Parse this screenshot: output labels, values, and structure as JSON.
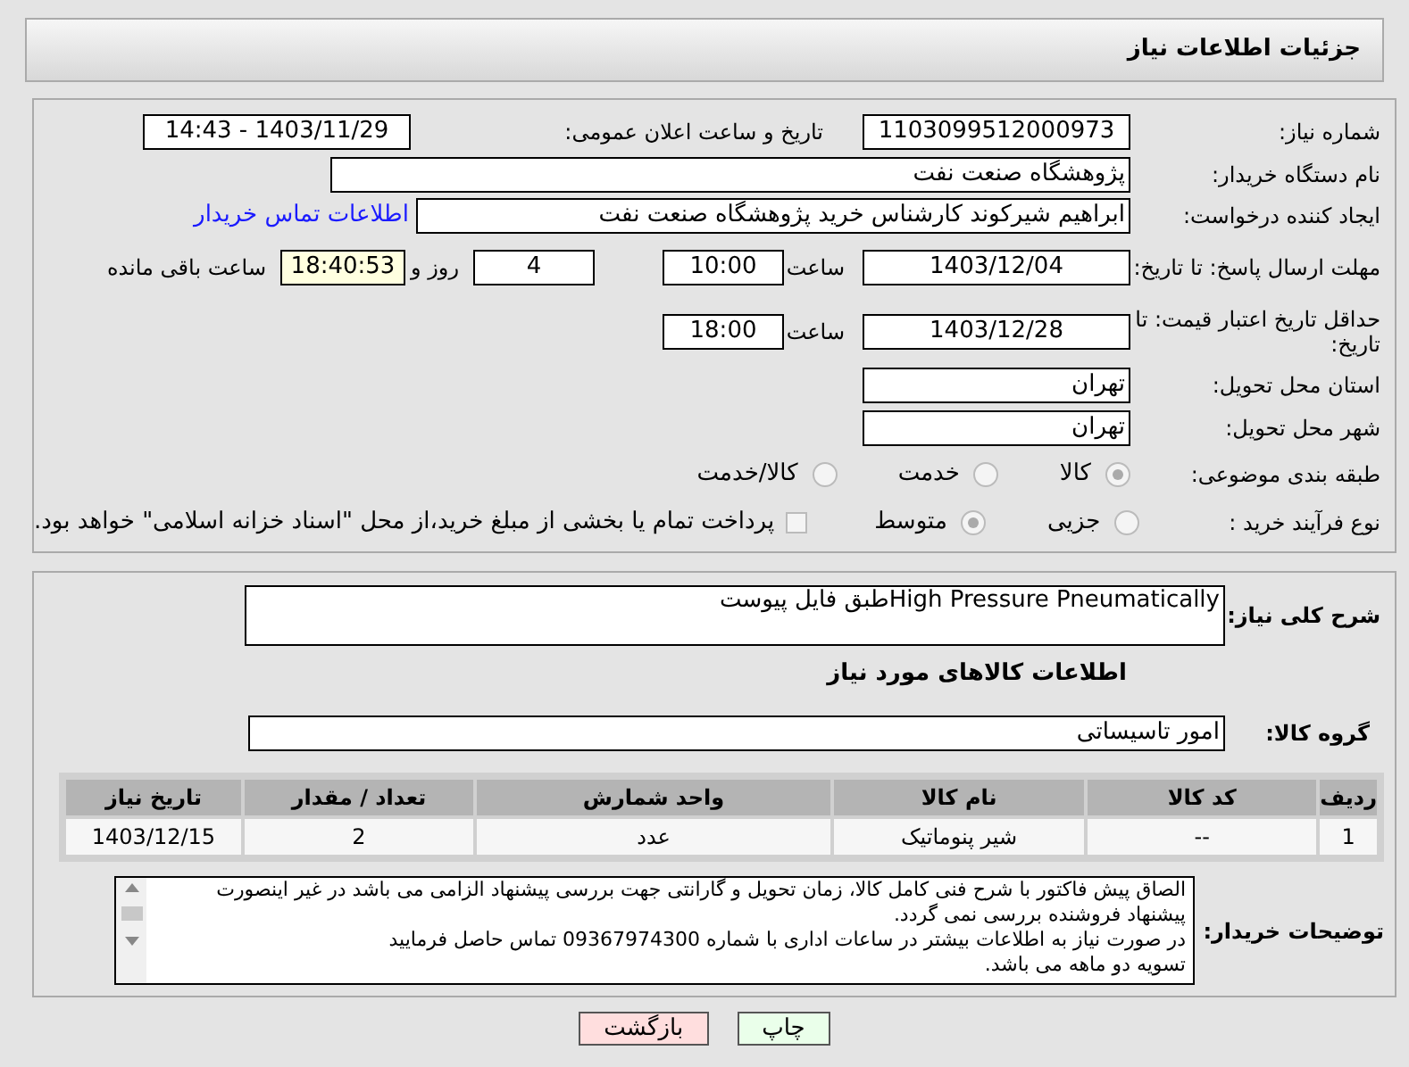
{
  "header": {
    "title": "جزئیات اطلاعات نیاز"
  },
  "need_number": {
    "label": "شماره نیاز:",
    "value": "1103099512000973"
  },
  "announce": {
    "label": "تاریخ و ساعت اعلان عمومی:",
    "value": "1403/11/29 - 14:43"
  },
  "buyer_org": {
    "label": "نام دستگاه خریدار:",
    "value": "پژوهشگاه صنعت نفت"
  },
  "requester": {
    "label": "ایجاد کننده درخواست:",
    "value": "ابراهیم شیرکوند کارشناس خرید پژوهشگاه صنعت نفت",
    "link": "اطلاعات تماس خریدار"
  },
  "reply_deadline": {
    "label": "مهلت ارسال پاسخ: تا تاریخ:",
    "date": "1403/12/04",
    "time_label": "ساعت",
    "time": "10:00",
    "days": "4",
    "days_label": "روز و",
    "remaining": "18:40:53",
    "remaining_label": "ساعت باقی مانده"
  },
  "price_validity": {
    "label": "حداقل تاریخ اعتبار قیمت: تا تاریخ:",
    "date": "1403/12/28",
    "time_label": "ساعت",
    "time": "18:00"
  },
  "province": {
    "label": "استان محل تحویل:",
    "value": "تهران"
  },
  "city": {
    "label": "شهر محل تحویل:",
    "value": "تهران"
  },
  "category": {
    "label": "طبقه بندی موضوعی:",
    "options": [
      {
        "label": "کالا",
        "selected": true
      },
      {
        "label": "خدمت",
        "selected": false
      },
      {
        "label": "کالا/خدمت",
        "selected": false
      }
    ]
  },
  "process": {
    "label": "نوع فرآیند خرید :",
    "options": [
      {
        "label": "جزیی",
        "selected": false
      },
      {
        "label": "متوسط",
        "selected": true
      }
    ],
    "treasury": {
      "label": "پرداخت تمام یا بخشی از مبلغ خرید،از محل \"اسناد خزانه اسلامی\" خواهد بود.",
      "checked": false
    }
  },
  "description": {
    "label": "شرح کلی نیاز:",
    "value": "High Pressure Pneumaticallyطبق فایل پیوست"
  },
  "goods_heading": "اطلاعات کالاهای مورد نیاز",
  "goods_group": {
    "label": "گروه کالا:",
    "value": "امور تاسیساتی"
  },
  "table": {
    "columns": [
      "ردیف",
      "کد کالا",
      "نام کالا",
      "واحد شمارش",
      "تعداد / مقدار",
      "تاریخ نیاز"
    ],
    "rows": [
      [
        "1",
        "--",
        "شیر پنوماتیک",
        "عدد",
        "2",
        "1403/12/15"
      ]
    ]
  },
  "buyer_notes": {
    "label": "توضیحات خریدار:",
    "lines": [
      "الصاق پیش فاکتور با شرح فنی کامل کالا، زمان تحویل و گارانتی جهت بررسی پیشنهاد الزامی می باشد در غیر اینصورت پیشنهاد فروشنده بررسی نمی گردد.",
      "در صورت نیاز به اطلاعات بیشتر در ساعات اداری با شماره 09367974300 تماس حاصل فرمایید",
      "تسویه دو ماهه می باشد."
    ]
  },
  "buttons": [
    {
      "label": "چاپ",
      "kind": "print"
    },
    {
      "label": "بازگشت",
      "kind": "back"
    }
  ]
}
